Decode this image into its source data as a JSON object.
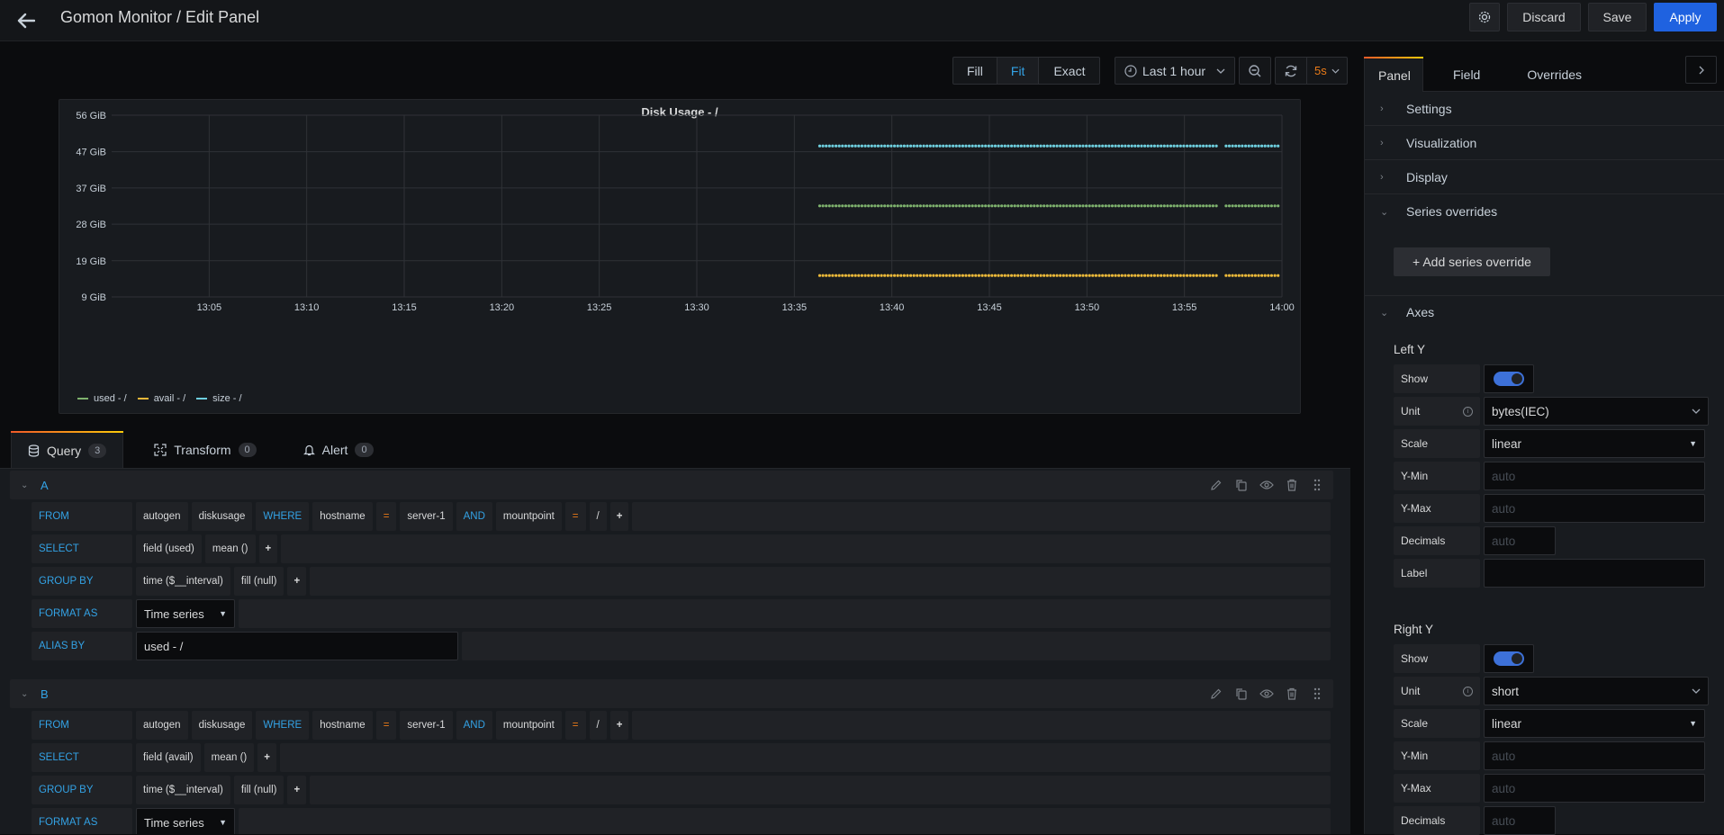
{
  "header": {
    "title": "Gomon Monitor / Edit Panel",
    "discard_label": "Discard",
    "save_label": "Save",
    "apply_label": "Apply"
  },
  "viz_toolbar": {
    "size_modes": [
      "Fill",
      "Fit",
      "Exact"
    ],
    "active_size_mode": "Fit",
    "time_range": "Last 1 hour",
    "refresh_interval": "5s"
  },
  "panel": {
    "title": "Disk Usage - /"
  },
  "chart_data": {
    "type": "scatter",
    "title": "Disk Usage - /",
    "xlabel": "",
    "ylabel": "",
    "x_ticks": [
      "13:05",
      "13:10",
      "13:15",
      "13:20",
      "13:25",
      "13:30",
      "13:35",
      "13:40",
      "13:45",
      "13:50",
      "13:55",
      "14:00"
    ],
    "y_ticks": [
      "9 GiB",
      "19 GiB",
      "28 GiB",
      "37 GiB",
      "47 GiB",
      "56 GiB"
    ],
    "y_tick_values": [
      9.3,
      18.6,
      28.0,
      37.3,
      46.6,
      56.0
    ],
    "ylim": [
      9.3,
      56.0
    ],
    "x_range_minutes": [
      0,
      60
    ],
    "x_range_labels": [
      "13:00",
      "14:00"
    ],
    "grid": true,
    "legend_position": "bottom-left",
    "data_start_minute": 36.3,
    "data_end_minute": 60,
    "gap_minutes": [
      56.7,
      57.1
    ],
    "point_interval_seconds": 10,
    "series": [
      {
        "name": "used - /",
        "color": "#7eb26d",
        "value": 32.7
      },
      {
        "name": "avail - /",
        "color": "#eab839",
        "value": 14.8
      },
      {
        "name": "size - /",
        "color": "#6ed0e0",
        "value": 48.1
      }
    ]
  },
  "query_tabs": [
    {
      "label": "Query",
      "count": "3",
      "icon": "database-icon"
    },
    {
      "label": "Transform",
      "count": "0",
      "icon": "transform-icon"
    },
    {
      "label": "Alert",
      "count": "0",
      "icon": "bell-icon"
    }
  ],
  "queries": [
    {
      "name": "A",
      "from_label": "FROM",
      "from": [
        {
          "text": "autogen",
          "kind": "value"
        },
        {
          "text": "diskusage",
          "kind": "value"
        },
        {
          "text": "WHERE",
          "kind": "keyword"
        },
        {
          "text": "hostname",
          "kind": "value"
        },
        {
          "text": "=",
          "kind": "operator"
        },
        {
          "text": "server-1",
          "kind": "value"
        },
        {
          "text": "AND",
          "kind": "keyword"
        },
        {
          "text": "mountpoint",
          "kind": "value"
        },
        {
          "text": "=",
          "kind": "operator"
        },
        {
          "text": "/",
          "kind": "value"
        },
        {
          "text": "+",
          "kind": "plus"
        }
      ],
      "select_label": "SELECT",
      "select": [
        "field (used)",
        "mean ()",
        "+"
      ],
      "group_label": "GROUP BY",
      "group_by": [
        "time ($__interval)",
        "fill (null)",
        "+"
      ],
      "format_label": "FORMAT AS",
      "format_as": "Time series",
      "alias_label": "ALIAS BY",
      "alias": "used - /"
    },
    {
      "name": "B",
      "from_label": "FROM",
      "from": [
        {
          "text": "autogen",
          "kind": "value"
        },
        {
          "text": "diskusage",
          "kind": "value"
        },
        {
          "text": "WHERE",
          "kind": "keyword"
        },
        {
          "text": "hostname",
          "kind": "value"
        },
        {
          "text": "=",
          "kind": "operator"
        },
        {
          "text": "server-1",
          "kind": "value"
        },
        {
          "text": "AND",
          "kind": "keyword"
        },
        {
          "text": "mountpoint",
          "kind": "value"
        },
        {
          "text": "=",
          "kind": "operator"
        },
        {
          "text": "/",
          "kind": "value"
        },
        {
          "text": "+",
          "kind": "plus"
        }
      ],
      "select_label": "SELECT",
      "select": [
        "field (avail)",
        "mean ()",
        "+"
      ],
      "group_label": "GROUP BY",
      "group_by": [
        "time ($__interval)",
        "fill (null)",
        "+"
      ],
      "format_label": "FORMAT AS",
      "format_as": "Time series"
    }
  ],
  "options_pane": {
    "tabs": [
      "Panel",
      "Field",
      "Overrides"
    ],
    "active_tab": "Panel",
    "sections": [
      {
        "label": "Settings",
        "expanded": false
      },
      {
        "label": "Visualization",
        "expanded": false
      },
      {
        "label": "Display",
        "expanded": false
      },
      {
        "label": "Series overrides",
        "expanded": true
      },
      {
        "label": "Axes",
        "expanded": true
      }
    ],
    "add_override_label": "+ Add series override",
    "left_y": {
      "title": "Left Y",
      "show_label": "Show",
      "show": true,
      "unit_label": "Unit",
      "unit": "bytes(IEC)",
      "scale_label": "Scale",
      "scale": "linear",
      "ymin_label": "Y-Min",
      "ymin_placeholder": "auto",
      "ymax_label": "Y-Max",
      "ymax_placeholder": "auto",
      "decimals_label": "Decimals",
      "decimals_placeholder": "auto",
      "label_label": "Label",
      "label_value": ""
    },
    "right_y": {
      "title": "Right Y",
      "show_label": "Show",
      "show": true,
      "unit_label": "Unit",
      "unit": "short",
      "scale_label": "Scale",
      "scale": "linear",
      "ymin_label": "Y-Min",
      "ymin_placeholder": "auto",
      "ymax_label": "Y-Max",
      "ymax_placeholder": "auto",
      "decimals_label": "Decimals",
      "decimals_placeholder": "auto"
    }
  }
}
